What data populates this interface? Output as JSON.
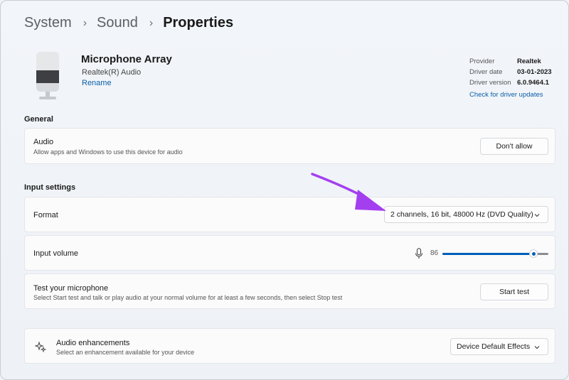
{
  "breadcrumb": {
    "items": [
      "System",
      "Sound",
      "Properties"
    ]
  },
  "device": {
    "name": "Microphone Array",
    "manufacturer": "Realtek(R) Audio",
    "rename_label": "Rename",
    "icon": "microphone-device-icon"
  },
  "driver": {
    "provider_label": "Provider",
    "provider_value": "Realtek",
    "date_label": "Driver date",
    "date_value": "03-01-2023",
    "version_label": "Driver version",
    "version_value": "6.0.9464.1",
    "update_link": "Check for driver updates"
  },
  "general": {
    "header": "General",
    "audio": {
      "title": "Audio",
      "desc": "Allow apps and Windows to use this device for audio",
      "button": "Don't allow"
    }
  },
  "input_settings": {
    "header": "Input settings",
    "format": {
      "title": "Format",
      "selected": "2 channels, 16 bit, 48000 Hz (DVD Quality)"
    },
    "volume": {
      "title": "Input volume",
      "value": 86,
      "icon": "microphone-icon"
    },
    "test": {
      "title": "Test your microphone",
      "desc": "Select Start test and talk or play audio at your normal volume for at least a few seconds, then select Stop test",
      "button": "Start test"
    }
  },
  "enhancements": {
    "title": "Audio enhancements",
    "desc": "Select an enhancement available for your device",
    "selected": "Device Default Effects",
    "icon": "sparkle-icon"
  },
  "colors": {
    "accent": "#005fb8",
    "link": "#0a5ea8",
    "annotation_arrow": "#a43ff0"
  }
}
